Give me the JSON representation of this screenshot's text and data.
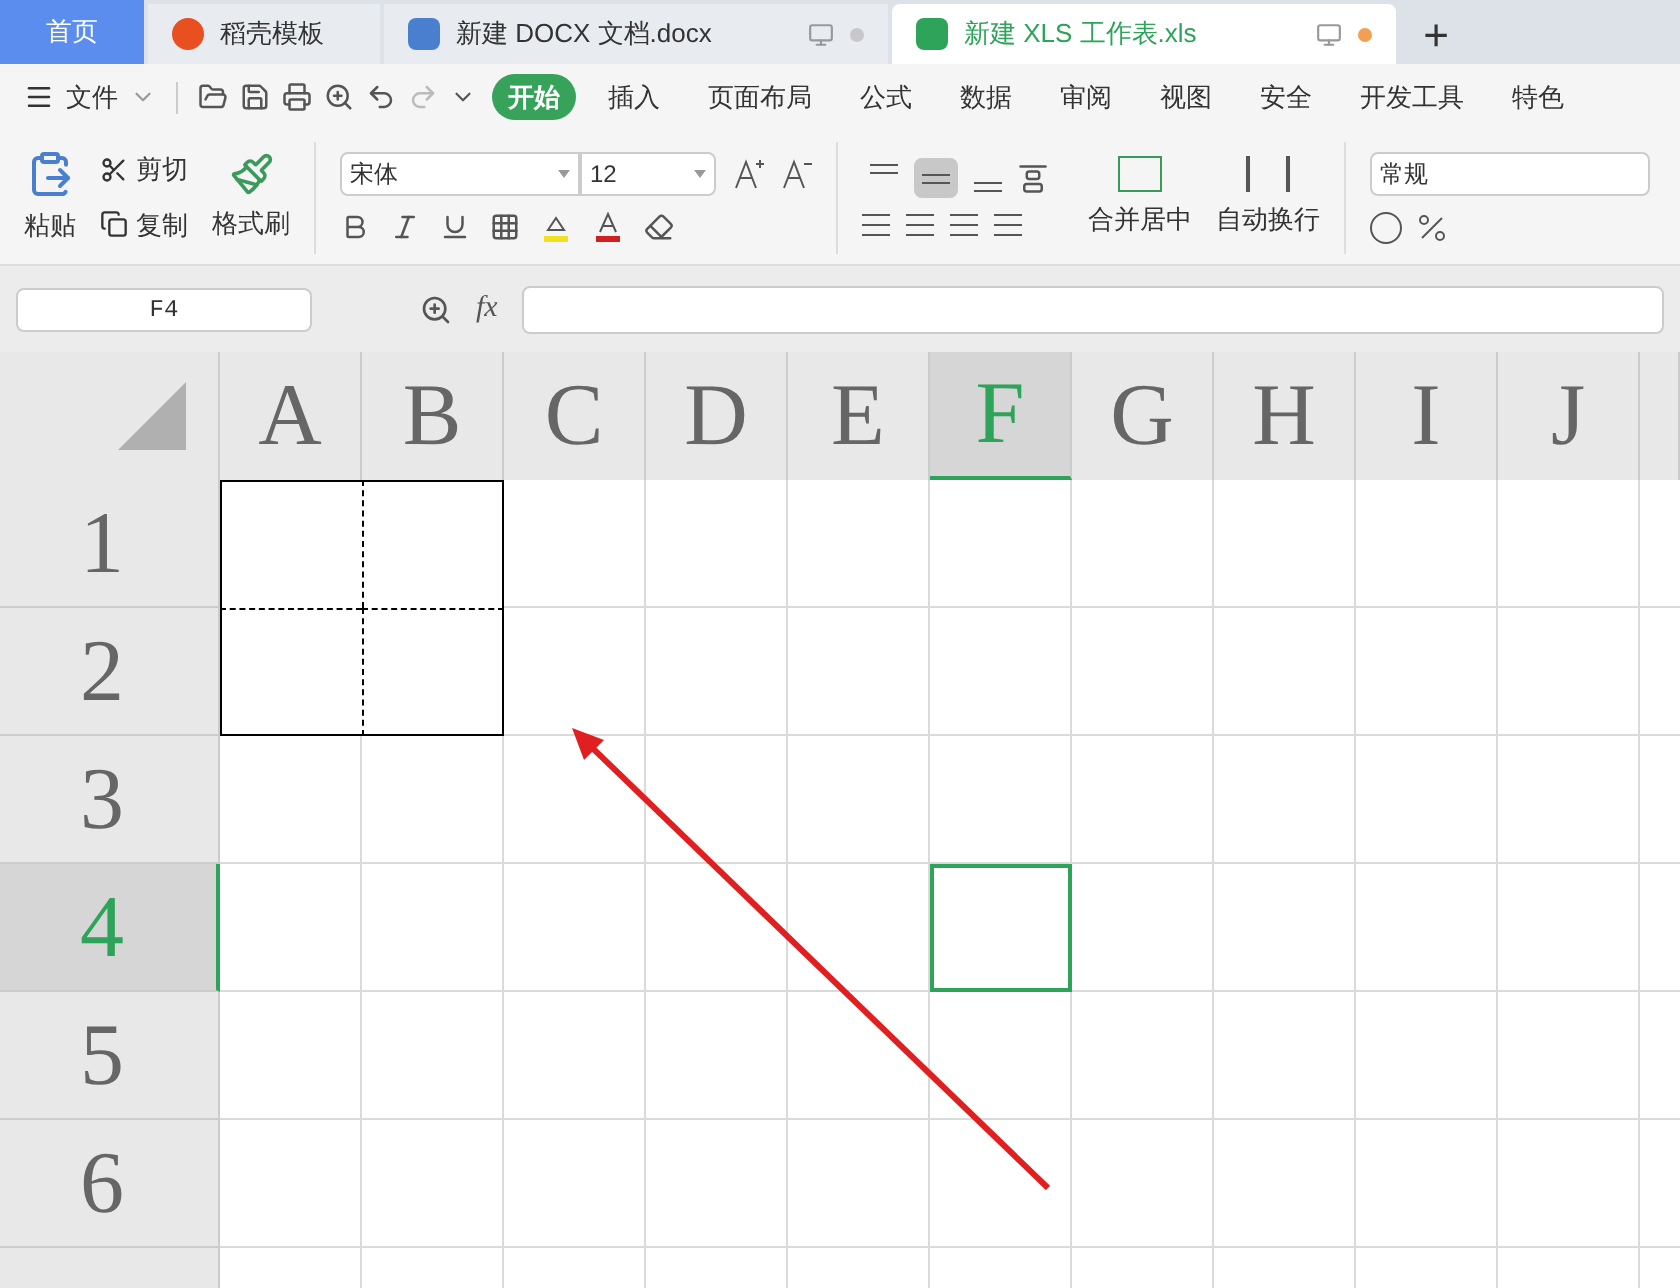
{
  "tabs": [
    {
      "kind": "home",
      "label": "首页",
      "selected": false
    },
    {
      "kind": "template",
      "label": "稻壳模板",
      "selected": false
    },
    {
      "kind": "docx",
      "label": "新建 DOCX 文档.docx",
      "selected": false,
      "modified": false
    },
    {
      "kind": "xls",
      "label": "新建 XLS 工作表.xls",
      "selected": true,
      "modified": true
    }
  ],
  "new_tab": "+",
  "file_menu": "文件",
  "menu": [
    {
      "label": "开始",
      "selected": true
    },
    {
      "label": "插入",
      "selected": false
    },
    {
      "label": "页面布局",
      "selected": false
    },
    {
      "label": "公式",
      "selected": false
    },
    {
      "label": "数据",
      "selected": false
    },
    {
      "label": "审阅",
      "selected": false
    },
    {
      "label": "视图",
      "selected": false
    },
    {
      "label": "安全",
      "selected": false
    },
    {
      "label": "开发工具",
      "selected": false
    },
    {
      "label": "特色",
      "selected": false
    }
  ],
  "ribbon": {
    "paste": "粘贴",
    "cut": "剪切",
    "copy": "复制",
    "format_painter": "格式刷",
    "font_name": "宋体",
    "font_size": "12",
    "vertical_align": [
      {
        "kind": "top",
        "selected": false
      },
      {
        "kind": "middle",
        "selected": true
      },
      {
        "kind": "bottom",
        "selected": false
      }
    ],
    "merge": "合并居中",
    "wrap": "自动换行",
    "number_format": "常规"
  },
  "formula_bar": {
    "name_box": "F4",
    "fx": "fx"
  },
  "columns": [
    {
      "label": "A",
      "selected": false,
      "bordered": true
    },
    {
      "label": "B",
      "selected": false,
      "bordered": true
    },
    {
      "label": "C",
      "selected": false,
      "bordered": false
    },
    {
      "label": "D",
      "selected": false,
      "bordered": false
    },
    {
      "label": "E",
      "selected": false,
      "bordered": false
    },
    {
      "label": "F",
      "selected": true,
      "bordered": false
    },
    {
      "label": "G",
      "selected": false,
      "bordered": false
    },
    {
      "label": "H",
      "selected": false,
      "bordered": false
    },
    {
      "label": "I",
      "selected": false,
      "bordered": false
    },
    {
      "label": "J",
      "selected": false,
      "bordered": false
    }
  ],
  "rows": [
    {
      "label": "1",
      "selected": false,
      "bordered": true
    },
    {
      "label": "2",
      "selected": false,
      "bordered": true
    },
    {
      "label": "3",
      "selected": false,
      "bordered": false
    },
    {
      "label": "4",
      "selected": true,
      "bordered": false
    },
    {
      "label": "5",
      "selected": false,
      "bordered": false
    },
    {
      "label": "6",
      "selected": false,
      "bordered": false
    }
  ]
}
